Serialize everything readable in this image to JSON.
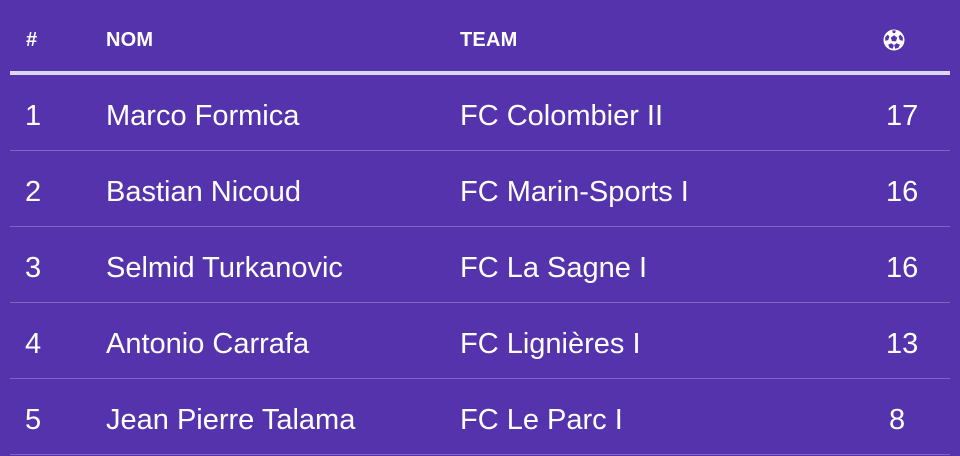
{
  "table": {
    "headers": {
      "rank": "#",
      "name": "NOM",
      "team": "TEAM",
      "goals_icon": "soccer-ball-icon"
    },
    "rows": [
      {
        "rank": "1",
        "name": "Marco Formica",
        "team": "FC Colombier II",
        "goals": "17"
      },
      {
        "rank": "2",
        "name": "Bastian Nicoud",
        "team": "FC Marin-Sports I",
        "goals": "16"
      },
      {
        "rank": "3",
        "name": "Selmid Turkanovic",
        "team": "FC La Sagne I",
        "goals": "16"
      },
      {
        "rank": "4",
        "name": "Antonio Carrafa",
        "team": "FC Lignières I",
        "goals": "13"
      },
      {
        "rank": "5",
        "name": "Jean Pierre Talama",
        "team": "FC Le Parc I",
        "goals": "8"
      }
    ]
  },
  "colors": {
    "background": "#5433ad",
    "text": "#ffffff",
    "header_rule": "#dcd6ee",
    "row_divider": "#7e65c5"
  }
}
